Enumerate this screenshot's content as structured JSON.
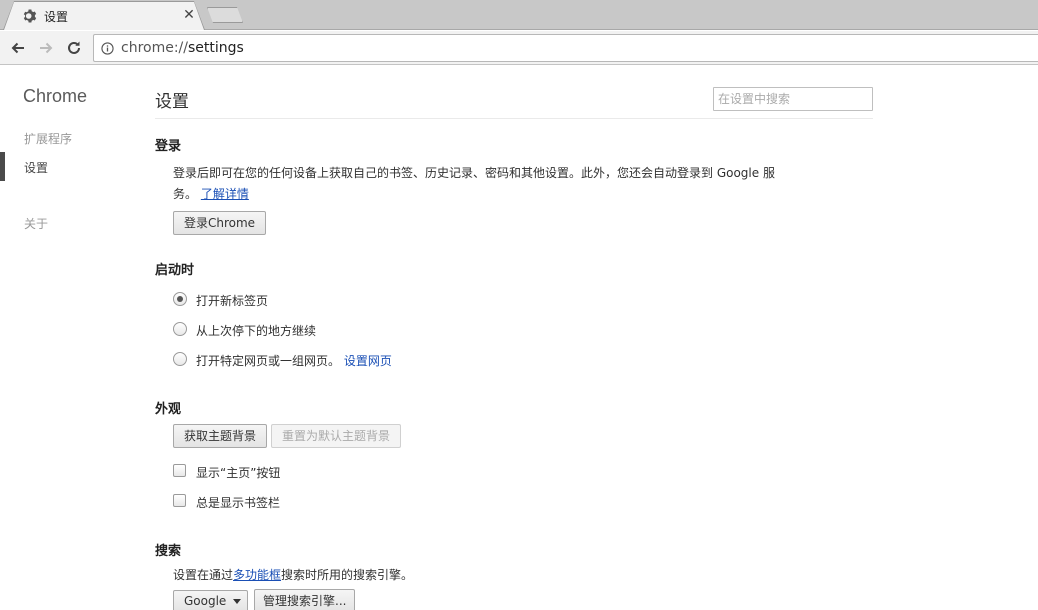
{
  "tab": {
    "title": "设置",
    "close": "✕",
    "icon": "gear-icon"
  },
  "omnibox": {
    "scheme": "chrome://",
    "host": "settings",
    "icon": "info-icon"
  },
  "sidebar": {
    "brand": "Chrome",
    "items": [
      {
        "label": "扩展程序",
        "active": false
      },
      {
        "label": "设置",
        "active": true
      },
      {
        "label": "关于",
        "active": false
      }
    ]
  },
  "main": {
    "title": "设置",
    "search_placeholder": "在设置中搜索",
    "signin": {
      "heading": "登录",
      "desc_line1": "登录后即可在您的任何设备上获取自己的书签、历史记录、密码和其他设置。此外，您还会自动登录到 Google 服",
      "desc_line2": "务。",
      "learn_more": "了解详情",
      "button": "登录Chrome"
    },
    "startup": {
      "heading": "启动时",
      "options": [
        {
          "label": "打开新标签页",
          "checked": true
        },
        {
          "label": "从上次停下的地方继续",
          "checked": false
        },
        {
          "label": "打开特定网页或一组网页。",
          "checked": false,
          "link": "设置网页"
        }
      ]
    },
    "appearance": {
      "heading": "外观",
      "get_themes": "获取主题背景",
      "reset_theme": "重置为默认主题背景",
      "checkboxes": [
        {
          "label": "显示“主页”按钮",
          "checked": false
        },
        {
          "label": "总是显示书签栏",
          "checked": false
        }
      ]
    },
    "search": {
      "heading": "搜索",
      "desc_before": "设置在通过",
      "desc_link": "多功能框",
      "desc_after": "搜索时所用的搜索引擎。",
      "engine": "Google",
      "manage": "管理搜索引擎..."
    }
  }
}
